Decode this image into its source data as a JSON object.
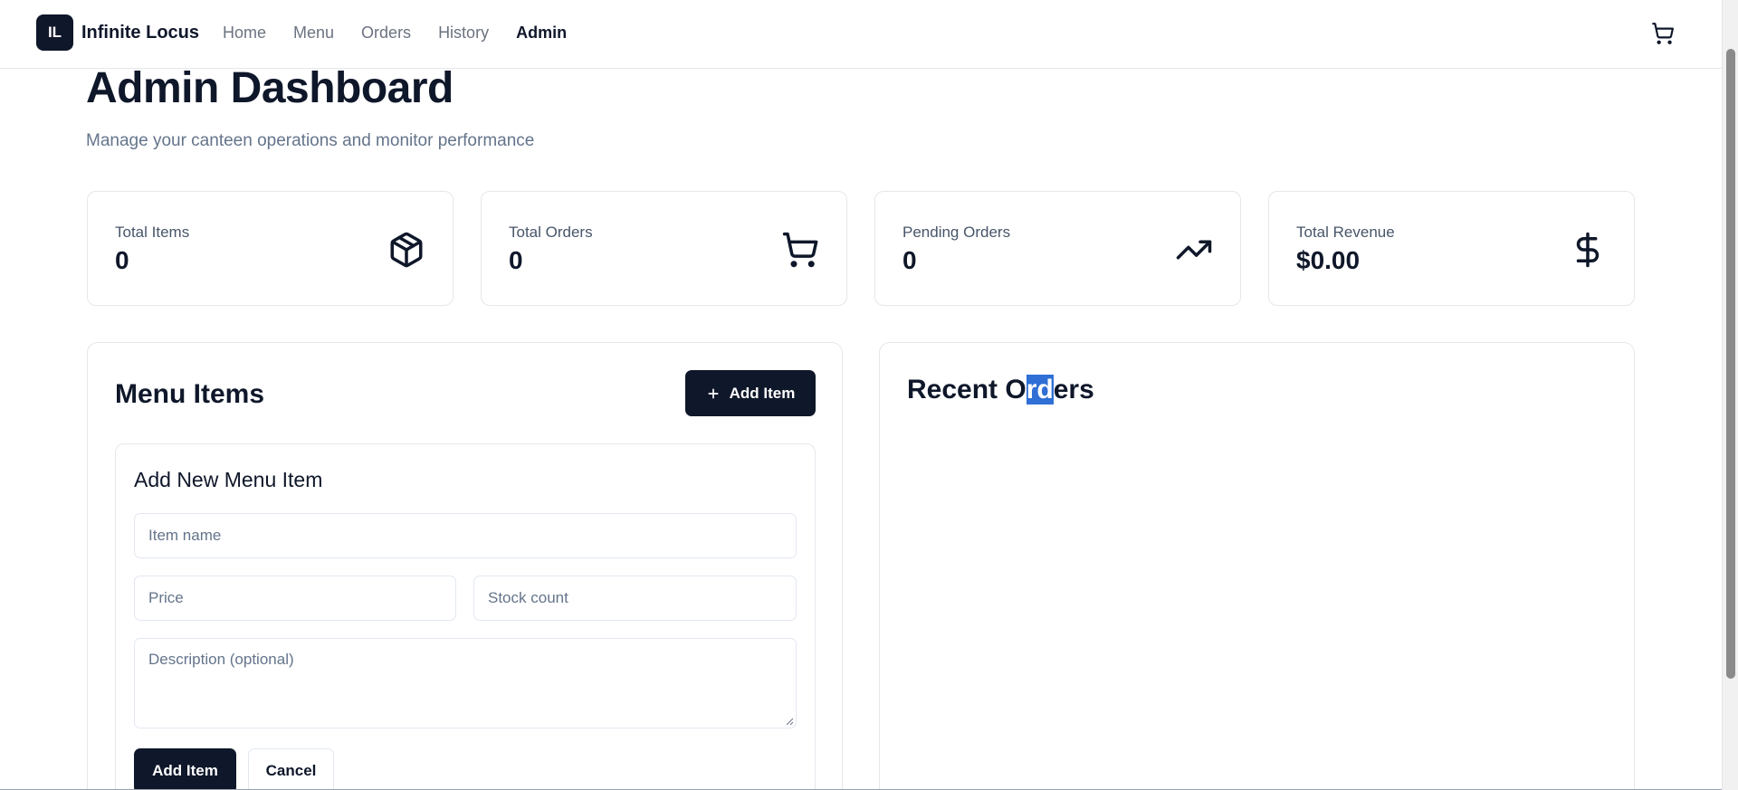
{
  "navbar": {
    "logo_text": "IL",
    "brand": "Infinite Locus",
    "links": [
      "Home",
      "Menu",
      "Orders",
      "History",
      "Admin"
    ],
    "active_link": "Admin",
    "cart_icon": "cart-icon"
  },
  "header": {
    "title": "Admin Dashboard",
    "subtitle": "Manage your canteen operations and monitor performance"
  },
  "stats": [
    {
      "label": "Total Items",
      "value": "0",
      "icon": "box-icon"
    },
    {
      "label": "Total Orders",
      "value": "0",
      "icon": "cart-icon"
    },
    {
      "label": "Pending Orders",
      "value": "0",
      "icon": "trending-up-icon"
    },
    {
      "label": "Total Revenue",
      "value": "$0.00",
      "icon": "dollar-icon"
    }
  ],
  "menu_panel": {
    "title": "Menu Items",
    "add_button": "Add Item",
    "form": {
      "title": "Add New Menu Item",
      "item_name_placeholder": "Item name",
      "price_placeholder": "Price",
      "stock_placeholder": "Stock count",
      "description_placeholder": "Description (optional)",
      "submit_label": "Add Item",
      "cancel_label": "Cancel"
    }
  },
  "orders_panel": {
    "title_before": "Recent O",
    "title_selected": "rd",
    "title_after": "ers"
  },
  "colors": {
    "primary": "#0f172a",
    "muted": "#64748b",
    "border": "#e5e7eb",
    "selection": "#2f6fd6"
  }
}
